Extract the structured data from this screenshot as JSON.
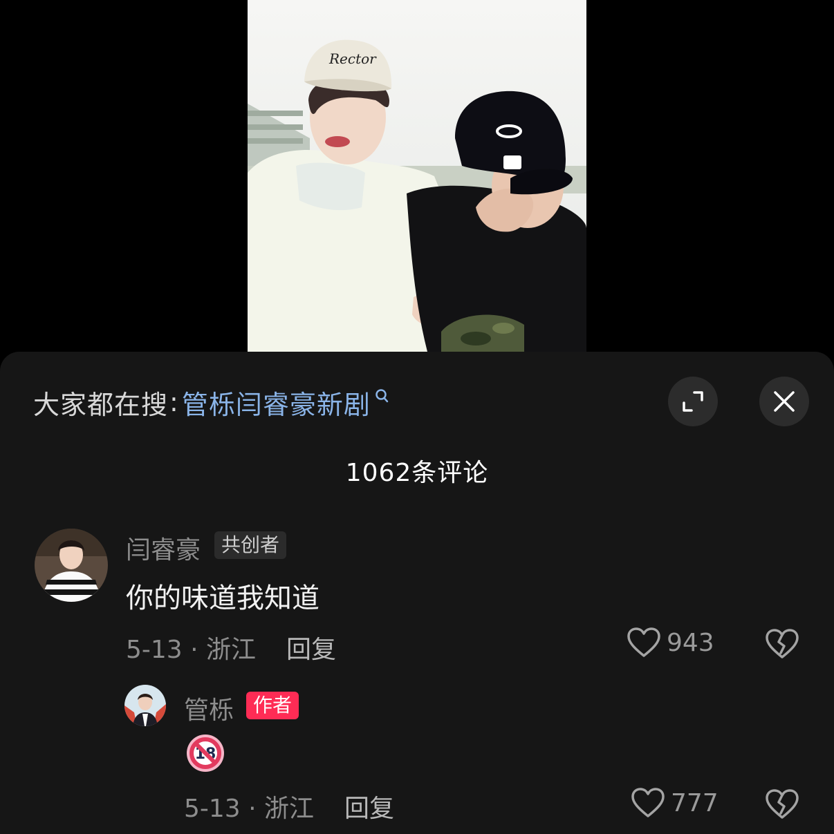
{
  "search": {
    "prefix": "大家都在搜",
    "separator": ":",
    "term": "管栎闫睿豪新剧"
  },
  "comments_header": {
    "count_label": "1062条评论"
  },
  "comments": [
    {
      "user": "闫睿豪",
      "badge": "共创者",
      "text": "你的味道我知道",
      "meta": "5-13 · 浙江",
      "reply_label": "回复",
      "likes": "943"
    }
  ],
  "replies": [
    {
      "user": "管栎",
      "badge": "作者",
      "emoji": "no-under-18-icon",
      "meta": "5-13 · 浙江",
      "reply_label": "回复",
      "likes": "777"
    }
  ],
  "colors": {
    "sheet_bg": "#161616",
    "search_term": "#8ab4e8",
    "author_badge": "#fe2c55"
  }
}
